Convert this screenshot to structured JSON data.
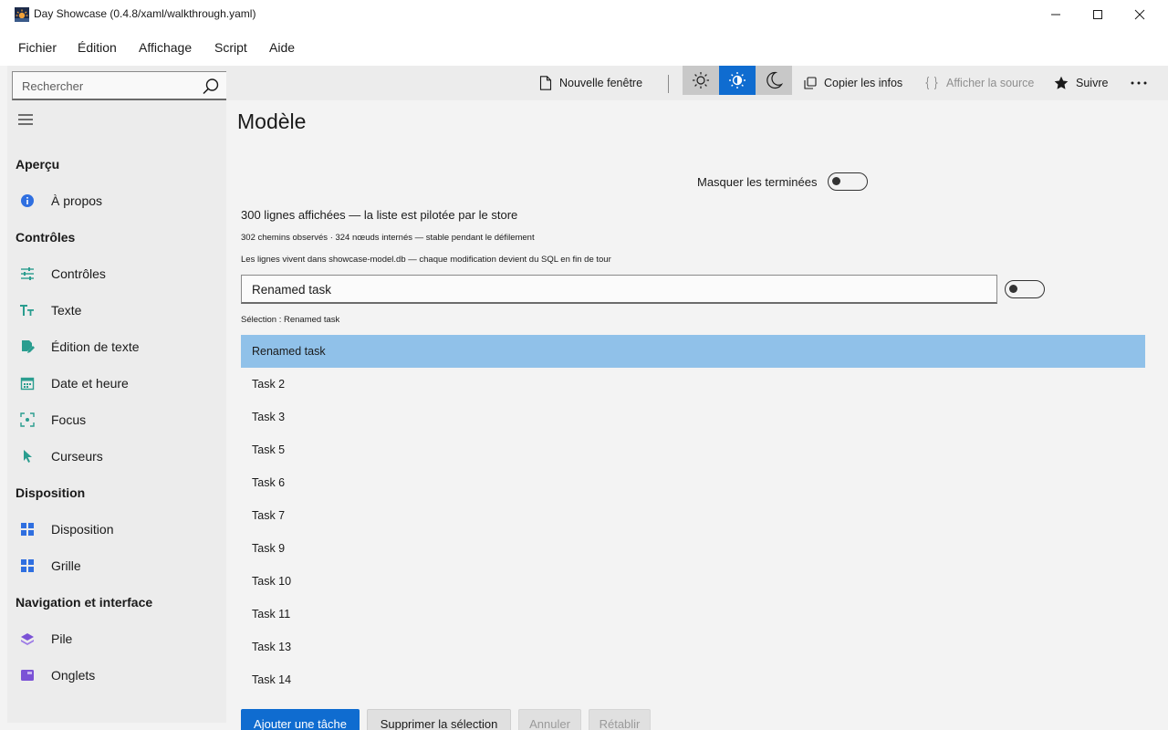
{
  "window": {
    "title": "Day Showcase (0.4.8/xaml/walkthrough.yaml)"
  },
  "menu": [
    "Fichier",
    "Édition",
    "Affichage",
    "Script",
    "Aide"
  ],
  "search": {
    "placeholder": "Rechercher",
    "value": ""
  },
  "nav": {
    "sections": [
      {
        "header": "Aperçu",
        "items": [
          {
            "label": "À propos",
            "icon": "info-icon",
            "color": "#2f6fe0"
          }
        ]
      },
      {
        "header": "Contrôles",
        "items": [
          {
            "label": "Contrôles",
            "icon": "sliders-icon",
            "color": "#2a9d8f"
          },
          {
            "label": "Texte",
            "icon": "text-size-icon",
            "color": "#2a9d8f"
          },
          {
            "label": "Édition de texte",
            "icon": "edit-document-icon",
            "color": "#2a9d8f"
          },
          {
            "label": "Date et heure",
            "icon": "calendar-icon",
            "color": "#2a9d8f"
          },
          {
            "label": "Focus",
            "icon": "focus-icon",
            "color": "#2a9d8f"
          },
          {
            "label": "Curseurs",
            "icon": "cursor-icon",
            "color": "#2a9d8f"
          }
        ]
      },
      {
        "header": "Disposition",
        "items": [
          {
            "label": "Disposition",
            "icon": "layout-icon",
            "color": "#2f6fe0"
          },
          {
            "label": "Grille",
            "icon": "grid-icon",
            "color": "#2f6fe0"
          }
        ]
      },
      {
        "header": "Navigation et interface",
        "items": [
          {
            "label": "Pile",
            "icon": "stack-icon",
            "color": "#7b52d6"
          },
          {
            "label": "Onglets",
            "icon": "tabs-icon",
            "color": "#7b52d6"
          }
        ]
      }
    ]
  },
  "toolbar": {
    "new_window": "Nouvelle fenêtre",
    "copy_info": "Copier les infos",
    "show_source": "Afficher la source",
    "follow": "Suivre",
    "theme_active": "contrast"
  },
  "page": {
    "title": "Modèle",
    "hide_completed_label": "Masquer les terminées",
    "hide_completed": false,
    "info_rows": "300 lignes affichées — la liste est pilotée par le store",
    "info_paths": "302 chemins observés · 324 nœuds internés — stable pendant le défilement",
    "info_db": "Les lignes vivent dans showcase-model.db — chaque modification devient du SQL en fin de tour",
    "edit_value": "Renamed task",
    "edit_toggle": false,
    "selection_label": "Sélection : Renamed task",
    "items": [
      "Renamed task",
      "Task 2",
      "Task 3",
      "Task 5",
      "Task 6",
      "Task 7",
      "Task 9",
      "Task 10",
      "Task 11",
      "Task 13",
      "Task 14"
    ],
    "selected_index": 0,
    "buttons": {
      "add": "Ajouter une tâche",
      "delete": "Supprimer la sélection",
      "undo": "Annuler",
      "redo": "Rétablir"
    }
  },
  "colors": {
    "accent": "#0f6cd0",
    "selection": "#90c1e9",
    "pane": "#ececec"
  }
}
